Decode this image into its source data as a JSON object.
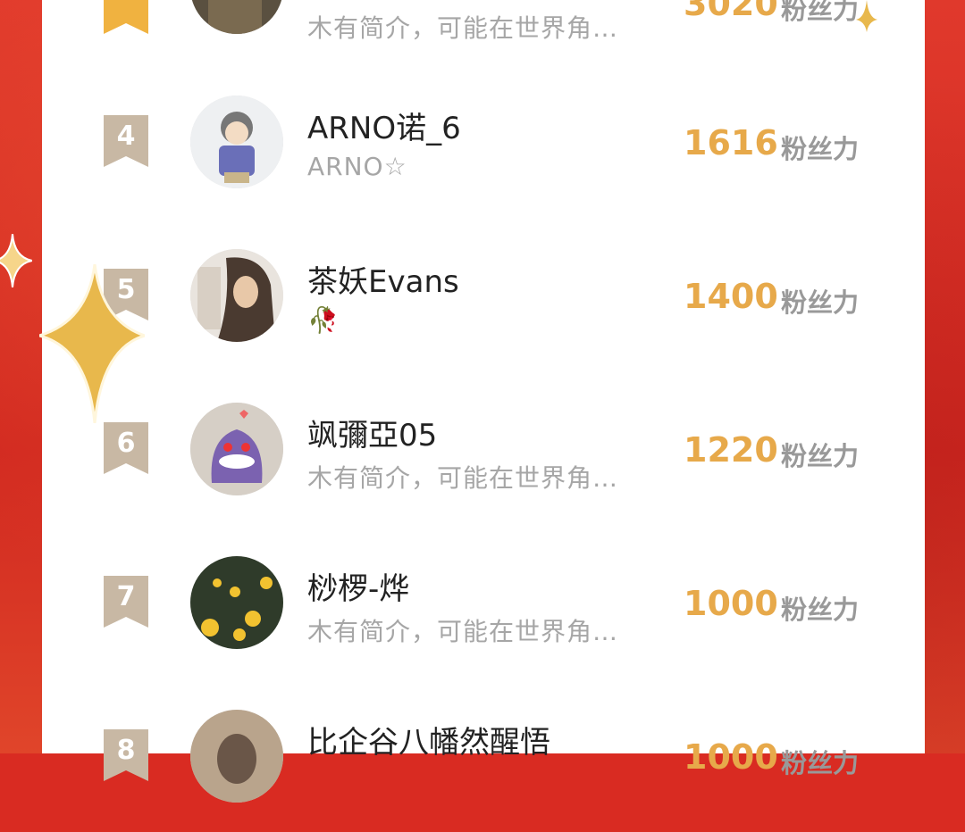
{
  "rows": [
    {
      "rank": "",
      "name": "",
      "bio": "木有简介，可能在世界角…",
      "score": "",
      "unit": "粉丝力"
    },
    {
      "rank": "4",
      "name": "ARNO诺_6",
      "bio": "ARNO☆",
      "score": "1616",
      "unit": "粉丝力"
    },
    {
      "rank": "5",
      "name": "茶妖Evans",
      "bio": "🥀",
      "score": "1400",
      "unit": "粉丝力"
    },
    {
      "rank": "6",
      "name": "飒彌亞05",
      "bio": "木有简介，可能在世界角…",
      "score": "1220",
      "unit": "粉丝力"
    },
    {
      "rank": "7",
      "name": "桫椤-烨",
      "bio": "木有简介，可能在世界角…",
      "score": "1000",
      "unit": "粉丝力"
    },
    {
      "rank": "8",
      "name": "比企谷八幡然醒悟",
      "bio": "",
      "score": "1000",
      "unit": "粉丝力"
    }
  ],
  "colors": {
    "background": "#d92b22",
    "card": "#ffffff",
    "score": "#e7a94a",
    "rank_badge": "#c8b8a4",
    "top_badge": "#f0b240"
  },
  "icons": [
    "ribbon-badge-icon",
    "sparkle-star-icon"
  ]
}
